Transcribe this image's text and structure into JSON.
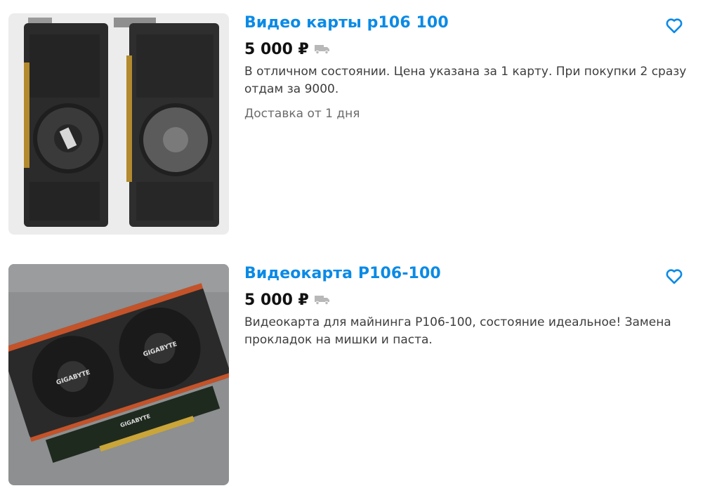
{
  "listings": [
    {
      "title": "Видео карты р106 100",
      "price": "5 000 ₽",
      "description": "В отличном состоянии. Цена указана за 1 карту. При покупки 2 сразу отдам за 9000.",
      "delivery": "Доставка от 1 дня",
      "image": "two-black-graphics-cards-photo"
    },
    {
      "title": "Видеокарта P106-100",
      "price": "5 000 ₽",
      "description": "Видеокарта для майнинга P106-100, состояние идеальное! Замена прокладок на мишки и паста.",
      "image": "gigabyte-graphics-card-photo",
      "image_labels": [
        "GIGABYTE",
        "GIGABYTE",
        "GIGABYTE"
      ]
    }
  ],
  "colors": {
    "title": "#0a8ae6",
    "favorite_icon": "#0a8ae6",
    "price": "#111111",
    "description": "#3d3d3d",
    "delivery": "#6b6b6b",
    "truck_icon": "#b8b8b8"
  },
  "icons": [
    "heart-icon",
    "truck-icon"
  ]
}
